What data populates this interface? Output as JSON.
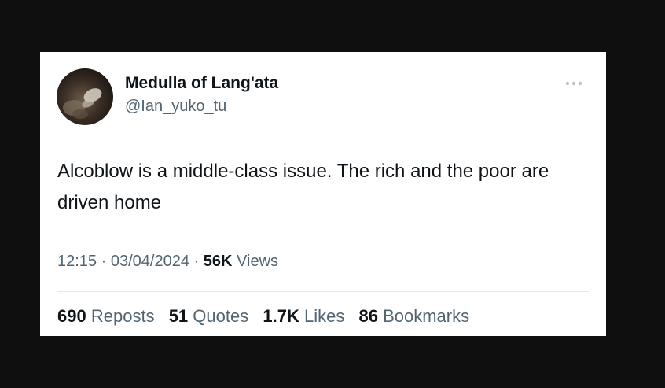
{
  "tweet": {
    "author": {
      "display_name": "Medulla of Lang'ata",
      "handle": "@Ian_yuko_tu",
      "avatar_icon": "profile-photo"
    },
    "more_icon": "more-horizontal-icon",
    "text": "Alcoblow is a middle-class issue. The rich and the poor are driven home",
    "time": "12:15",
    "separator": "·",
    "date": "03/04/2024",
    "views_count": "56K",
    "views_label": "Views",
    "stats": [
      {
        "count": "690",
        "label": "Reposts"
      },
      {
        "count": "51",
        "label": "Quotes"
      },
      {
        "count": "1.7K",
        "label": "Likes"
      },
      {
        "count": "86",
        "label": "Bookmarks"
      }
    ]
  },
  "colors": {
    "background": "#0f0f0f",
    "card": "#ffffff",
    "primary_text": "#0f1419",
    "secondary_text": "#536471",
    "divider": "#e6e9eb"
  }
}
